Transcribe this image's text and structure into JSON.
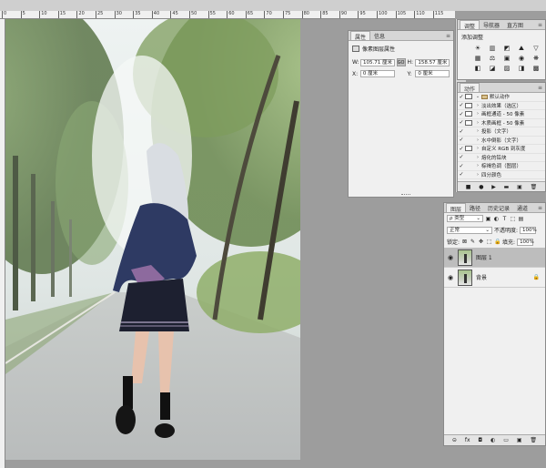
{
  "ruler": {
    "ticks": [
      "0",
      "5",
      "10",
      "15",
      "20",
      "25",
      "30",
      "35",
      "40",
      "45",
      "50",
      "55",
      "60",
      "65",
      "70",
      "75",
      "80",
      "85",
      "90",
      "95",
      "100",
      "105",
      "110",
      "115"
    ]
  },
  "properties": {
    "tabs": [
      "属性",
      "信息"
    ],
    "title": "像素图层属性",
    "w_label": "W:",
    "w_value": "105.71 厘米",
    "link_label": "GO",
    "h_label": "H:",
    "h_value": "158.57 厘米",
    "x_label": "X:",
    "x_value": "0 厘米",
    "y_label": "Y:",
    "y_value": "0 厘米"
  },
  "adjustments": {
    "tabs": [
      "调整",
      "导航器",
      "直方图"
    ],
    "title": "添加调整",
    "icons_row1": [
      "☀",
      "▥",
      "◩",
      "⛰",
      "▽"
    ],
    "icons_row2": [
      "▦",
      "⚖",
      "▣",
      "◉",
      "❋",
      "▤"
    ],
    "icons_row3": [
      "◧",
      "◪",
      "▨",
      "◨",
      "▩"
    ]
  },
  "actions": {
    "tabs": [
      "动作"
    ],
    "items": [
      {
        "check": "✓",
        "dialog": true,
        "arrow": "⌄",
        "folder": true,
        "label": "默认动作"
      },
      {
        "check": "✓",
        "dialog": true,
        "arrow": "›",
        "folder": false,
        "label": "淡出效果（选区）"
      },
      {
        "check": "✓",
        "dialog": true,
        "arrow": "›",
        "folder": false,
        "label": "画框通道 - 50 像素"
      },
      {
        "check": "✓",
        "dialog": true,
        "arrow": "›",
        "folder": false,
        "label": "木质画框 - 50 像素"
      },
      {
        "check": "✓",
        "dialog": false,
        "arrow": "›",
        "folder": false,
        "label": "投影（文字）"
      },
      {
        "check": "✓",
        "dialog": false,
        "arrow": "›",
        "folder": false,
        "label": "水中倒影（文字）"
      },
      {
        "check": "✓",
        "dialog": true,
        "arrow": "›",
        "folder": false,
        "label": "自定义 RGB 到灰度"
      },
      {
        "check": "✓",
        "dialog": false,
        "arrow": "›",
        "folder": false,
        "label": "熔化的铅块"
      },
      {
        "check": "✓",
        "dialog": false,
        "arrow": "›",
        "folder": false,
        "label": "棕褐色调（图层）"
      },
      {
        "check": "✓",
        "dialog": false,
        "arrow": "›",
        "folder": false,
        "label": "四分颜色"
      }
    ],
    "footer_icons": [
      "■",
      "●",
      "▶",
      "▬",
      "▣",
      "🗑"
    ]
  },
  "layers": {
    "tabs": [
      "图层",
      "路径",
      "历史记录",
      "通道"
    ],
    "filter_label": "ρ 类型",
    "filter_icons": [
      "▣",
      "◐",
      "T",
      "⬚",
      "▤"
    ],
    "blend_mode": "正常",
    "opacity_label": "不透明度:",
    "opacity_value": "100%",
    "lock_label": "锁定:",
    "lock_icons": [
      "⊠",
      "✎",
      "✥",
      "⬚",
      "🔒"
    ],
    "fill_label": "填充:",
    "fill_value": "100%",
    "items": [
      {
        "name": "图层 1",
        "selected": true,
        "locked": false
      },
      {
        "name": "背景",
        "selected": false,
        "locked": true
      }
    ],
    "footer_icons": [
      "⊝",
      "fx",
      "◘",
      "◐",
      "▭",
      "▣",
      "🗑"
    ]
  }
}
